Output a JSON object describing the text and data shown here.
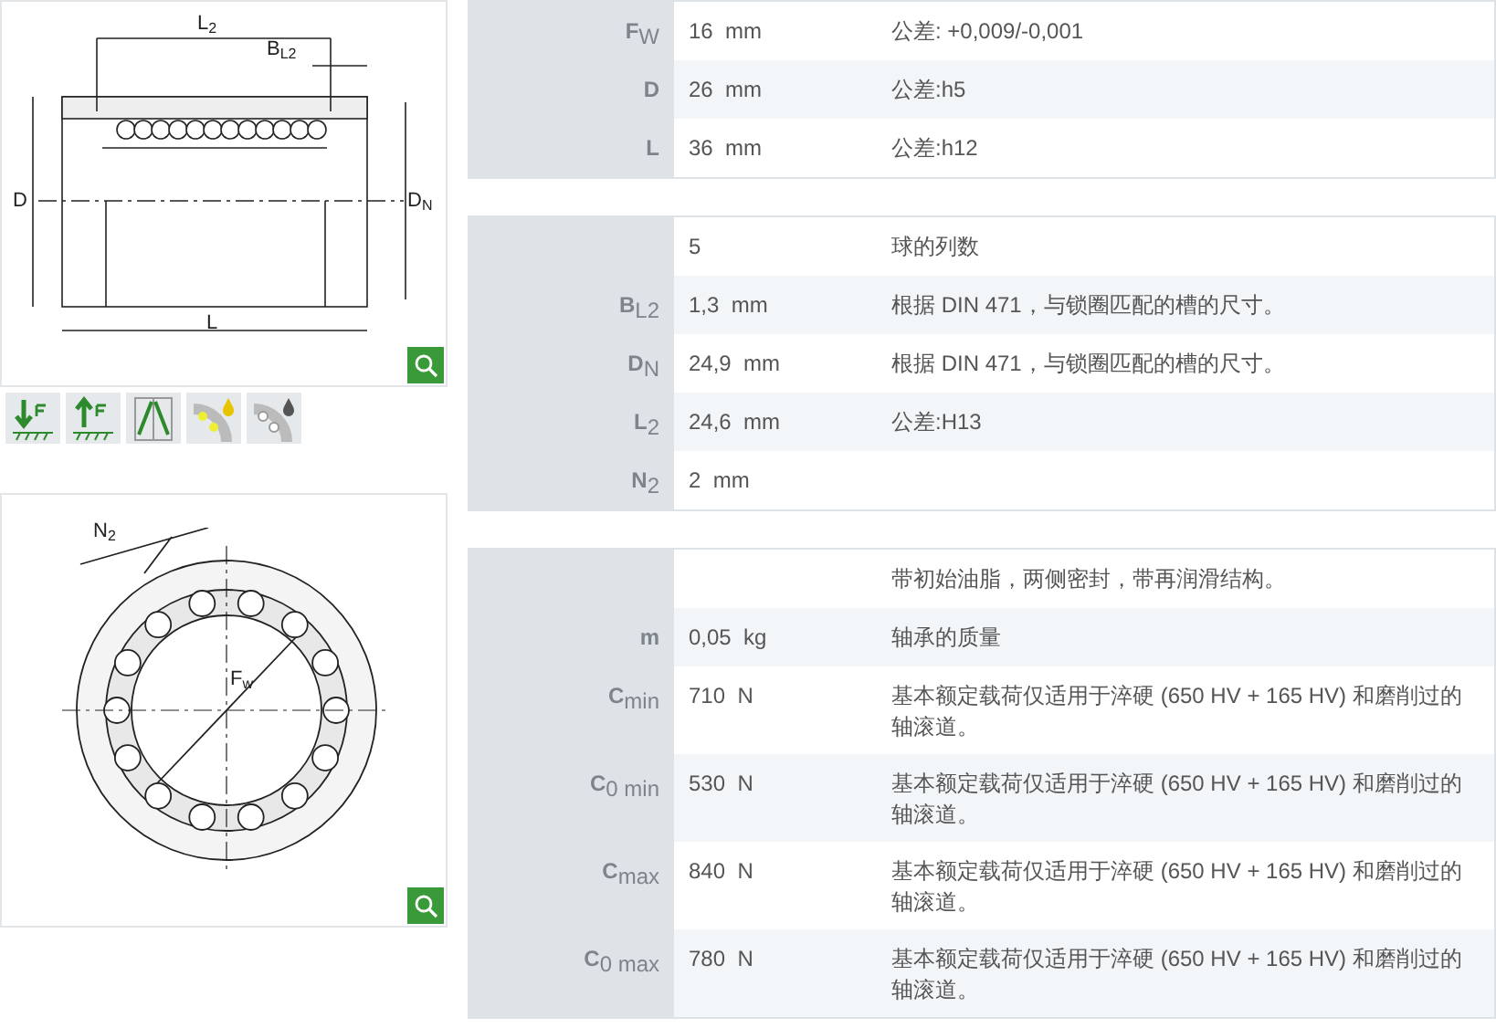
{
  "side_view": {
    "labels": [
      "L$_{2}$",
      "B$_{L2}$",
      "D",
      "D$_{N}$",
      "L"
    ]
  },
  "feature_icons": [
    {
      "kind": "load-down"
    },
    {
      "kind": "load-up"
    },
    {
      "kind": "angle"
    },
    {
      "kind": "oil"
    },
    {
      "kind": "drop"
    }
  ],
  "section_view": {
    "labels": [
      "N$_{2}$",
      "F$_{w}$"
    ]
  },
  "groups": [
    {
      "rows": [
        {
          "label": "F$_{W}$",
          "value": "16  mm",
          "note": "公差: +0,009/-0,001"
        },
        {
          "label": "D",
          "value": "26  mm",
          "note": "公差:h5"
        },
        {
          "label": "L",
          "value": "36  mm",
          "note": "公差:h12"
        }
      ]
    },
    {
      "rows": [
        {
          "label": "",
          "value": "5",
          "note": "球的列数"
        },
        {
          "label": "B$_{L2}$",
          "value": "1,3  mm",
          "note": "根据 DIN 471，与锁圈匹配的槽的尺寸。"
        },
        {
          "label": "D$_{N}$",
          "value": "24,9  mm",
          "note": "根据 DIN 471，与锁圈匹配的槽的尺寸。"
        },
        {
          "label": "L$_{2}$",
          "value": "24,6  mm",
          "note": "公差:H13"
        },
        {
          "label": "N$_{2}$",
          "value": "2  mm",
          "note": ""
        }
      ]
    },
    {
      "rows": [
        {
          "label": "",
          "value": "",
          "note": "带初始油脂，两侧密封，带再润滑结构。"
        },
        {
          "label": "m",
          "value": "0,05  kg",
          "note": "轴承的质量"
        },
        {
          "label": "C$_{min}$",
          "value": "710  N",
          "note": "基本额定载荷仅适用于淬硬 (650 HV + 165 HV) 和磨削过的轴滚道。"
        },
        {
          "label": "C$_{0 min}$",
          "value": "530  N",
          "note": "基本额定载荷仅适用于淬硬 (650 HV + 165 HV) 和磨削过的轴滚道。"
        },
        {
          "label": "C$_{max}$",
          "value": "840  N",
          "note": "基本额定载荷仅适用于淬硬 (650 HV + 165 HV) 和磨削过的轴滚道。"
        },
        {
          "label": "C$_{0 max}$",
          "value": "780  N",
          "note": "基本额定载荷仅适用于淬硬 (650 HV + 165 HV) 和磨削过的轴滚道。"
        }
      ]
    }
  ]
}
